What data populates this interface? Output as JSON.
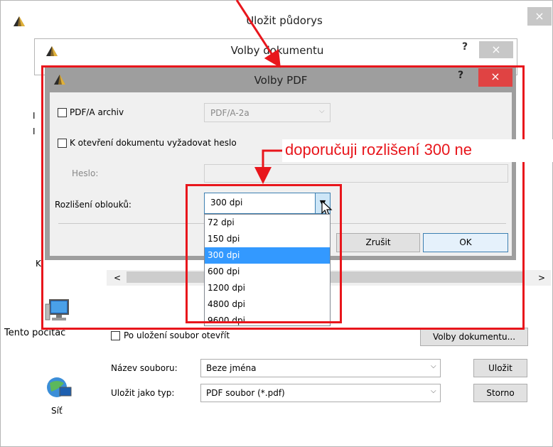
{
  "save_dialog": {
    "title": "Uložit půdorys",
    "close_glyph": "×",
    "this_pc_label": "Tento počítač",
    "network_label": "Síť",
    "open_after_save_label": "Po uložení soubor otevřít",
    "doc_options_button": "Volby dokumentu...",
    "filename_label": "Název souboru:",
    "filename_value": "Beze jména",
    "filetype_label": "Uložit jako typ:",
    "filetype_value": "PDF soubor (*.pdf)",
    "save_button": "Uložit",
    "cancel_button": "Storno",
    "partial_left_1": "I",
    "partial_left_2": "I",
    "partial_left_3": "K",
    "scroll_left": "<",
    "scroll_right": ">"
  },
  "doc_dialog": {
    "title": "Volby dokumentu",
    "help": "?",
    "close_glyph": "×"
  },
  "pdf_dialog": {
    "title": "Volby PDF",
    "help": "?",
    "close_glyph": "×",
    "pdfa_label": "PDF/A archiv",
    "pdfa_value": "PDF/A-2a",
    "password_req_label": "K otevření dokumentu vyžadovat heslo",
    "password_label": "Heslo:",
    "password_value": "",
    "resolution_label": "Rozlišení oblouků:",
    "resolution_value": "300 dpi",
    "resolution_options": [
      "72 dpi",
      "150 dpi",
      "300 dpi",
      "600 dpi",
      "1200 dpi",
      "4800 dpi",
      "9600 dpi"
    ],
    "selected_option_index": 2,
    "cancel_button": "Zrušit",
    "ok_button": "OK"
  },
  "annotation": {
    "text": "doporučuji rozlišení 300 ne",
    "color": "#e8161c"
  },
  "colors": {
    "selection": "#3399ff",
    "close_red": "#e04343",
    "dialog_frame": "#9e9e9e"
  }
}
